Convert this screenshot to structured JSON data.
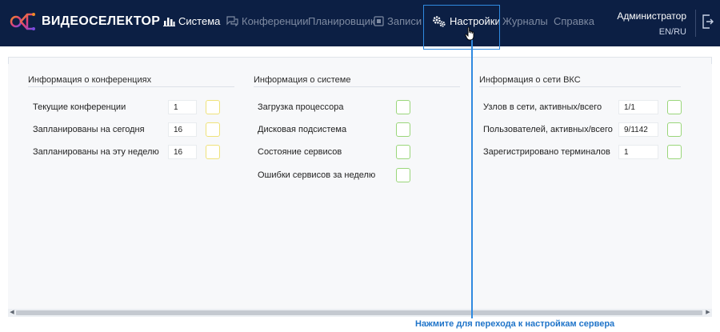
{
  "brand": {
    "name": "ВИДЕОСЕЛЕКТОР",
    "icon": "videoselector-logo"
  },
  "nav": {
    "items": [
      {
        "label": "Система",
        "icon": "bar-chart-icon",
        "state": "active"
      },
      {
        "label": "Конференции",
        "icon": "chat-icon",
        "state": "normal"
      },
      {
        "label": "Планировщик",
        "icon": "",
        "state": "normal"
      },
      {
        "label": "Записи",
        "icon": "record-icon",
        "state": "normal"
      },
      {
        "label": "Настройки",
        "icon": "gears-icon",
        "state": "hover"
      },
      {
        "label": "Журналы",
        "icon": "",
        "state": "normal"
      },
      {
        "label": "Справка",
        "icon": "",
        "state": "normal"
      }
    ]
  },
  "user": {
    "name": "Администратор",
    "language": "EN/RU",
    "logout_icon": "logout-icon"
  },
  "sections": {
    "conferences": {
      "title": "Информация о конференциях",
      "rows": [
        {
          "label": "Текущие конференции",
          "value": "1",
          "status": "yellow"
        },
        {
          "label": "Запланированы на сегодня",
          "value": "16",
          "status": "yellow"
        },
        {
          "label": "Запланированы на эту неделю",
          "value": "16",
          "status": "yellow"
        }
      ]
    },
    "system": {
      "title": "Информация о системе",
      "rows": [
        {
          "label": "Загрузка процессора",
          "status": "green"
        },
        {
          "label": "Дисковая подсистема",
          "status": "green"
        },
        {
          "label": "Состояние сервисов",
          "status": "green"
        },
        {
          "label": "Ошибки сервисов за неделю",
          "status": "green"
        }
      ]
    },
    "network": {
      "title": "Информация о сети ВКС",
      "rows": [
        {
          "label": "Узлов в сети, активных/всего",
          "value": "1/1",
          "status": "green"
        },
        {
          "label": "Пользователей, активных/всего",
          "value": "9/1142",
          "status": "green"
        },
        {
          "label": "Зарегистрировано терминалов",
          "value": "1",
          "status": "green"
        }
      ]
    }
  },
  "colors": {
    "header_bg": "#0c1f44",
    "accent": "#2f8ae0",
    "status_yellow": "#efe27a",
    "status_green": "#9ad67a"
  },
  "callout": {
    "text": "Нажмите для перехода к настройкам сервера"
  }
}
